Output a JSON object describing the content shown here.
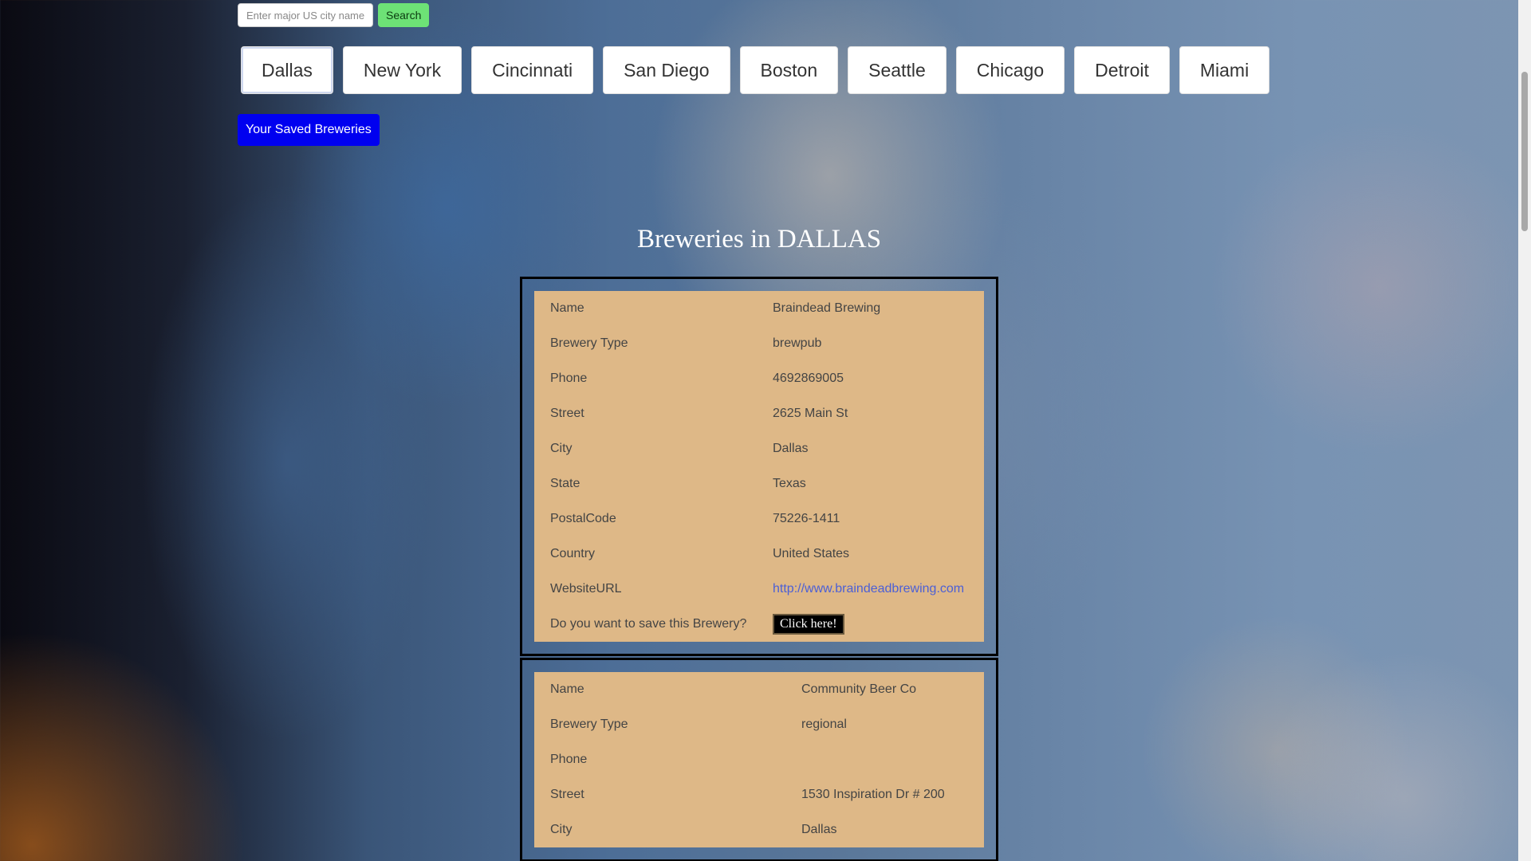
{
  "search": {
    "placeholder": "Enter major US city name",
    "button_label": "Search"
  },
  "cities": [
    "Dallas",
    "New York",
    "Cincinnati",
    "San Diego",
    "Boston",
    "Seattle",
    "Chicago",
    "Detroit",
    "Miami"
  ],
  "active_city": "Dallas",
  "saved_button_label": "Your Saved Breweries",
  "heading": "Breweries in DALLAS",
  "breweries": [
    {
      "rows": [
        {
          "label": "Name",
          "value": "Braindead Brewing"
        },
        {
          "label": "Brewery Type",
          "value": "brewpub"
        },
        {
          "label": "Phone",
          "value": "4692869005"
        },
        {
          "label": "Street",
          "value": "2625 Main St"
        },
        {
          "label": "City",
          "value": "Dallas"
        },
        {
          "label": "State",
          "value": "Texas"
        },
        {
          "label": "PostalCode",
          "value": "75226-1411"
        },
        {
          "label": "Country",
          "value": "United States"
        },
        {
          "label": "WebsiteURL",
          "value": "http://www.braindeadbrewing.com"
        }
      ],
      "save_prompt": "Do you want to save this Brewery?",
      "save_button": "Click here!"
    },
    {
      "rows": [
        {
          "label": "Name",
          "value": "Community Beer Co"
        },
        {
          "label": "Brewery Type",
          "value": "regional"
        },
        {
          "label": "Phone",
          "value": ""
        },
        {
          "label": "Street",
          "value": "1530 Inspiration Dr # 200"
        },
        {
          "label": "City",
          "value": "Dallas"
        }
      ]
    }
  ],
  "colors": {
    "card_bg": "#deb887",
    "search_button": "#6de276",
    "saved_button": "#0000f0",
    "link": "#4b5fd6"
  }
}
